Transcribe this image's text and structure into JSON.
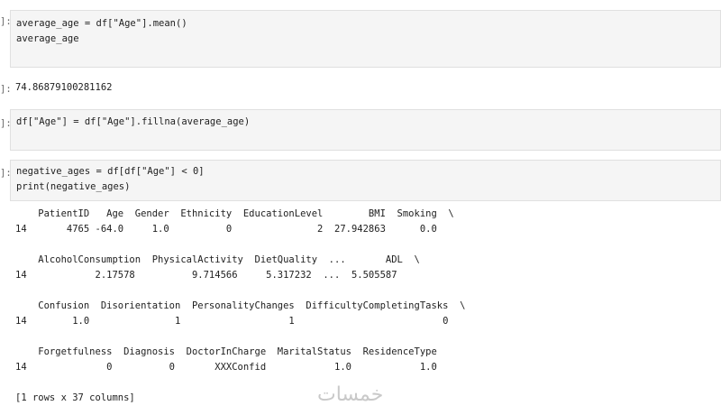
{
  "cells": [
    {
      "prompt": "]:",
      "lines": [
        "average_age = df[\"Age\"].mean()",
        "average_age"
      ]
    },
    {
      "prompt": "]:",
      "lines": [
        "df[\"Age\"] = df[\"Age\"].fillna(average_age)"
      ]
    },
    {
      "prompt": "]:",
      "lines": [
        "negative_ages = df[df[\"Age\"] < 0]",
        "print(negative_ages)"
      ]
    }
  ],
  "output_prompt": "]:",
  "mean_output": "74.86879100281162",
  "print_output": [
    "    PatientID   Age  Gender  Ethnicity  EducationLevel        BMI  Smoking  \\",
    "14       4765 -64.0     1.0          0               2  27.942863      0.0",
    "",
    "    AlcoholConsumption  PhysicalActivity  DietQuality  ...       ADL  \\",
    "14            2.17578          9.714566     5.317232  ...  5.505587",
    "",
    "    Confusion  Disorientation  PersonalityChanges  DifficultyCompletingTasks  \\",
    "14        1.0               1                   1                          0",
    "",
    "    Forgetfulness  Diagnosis  DoctorInCharge  MaritalStatus  ResidenceType",
    "14              0          0       XXXConfid            1.0            1.0",
    "",
    "[1 rows x 37 columns]"
  ],
  "watermark": "خمسات"
}
